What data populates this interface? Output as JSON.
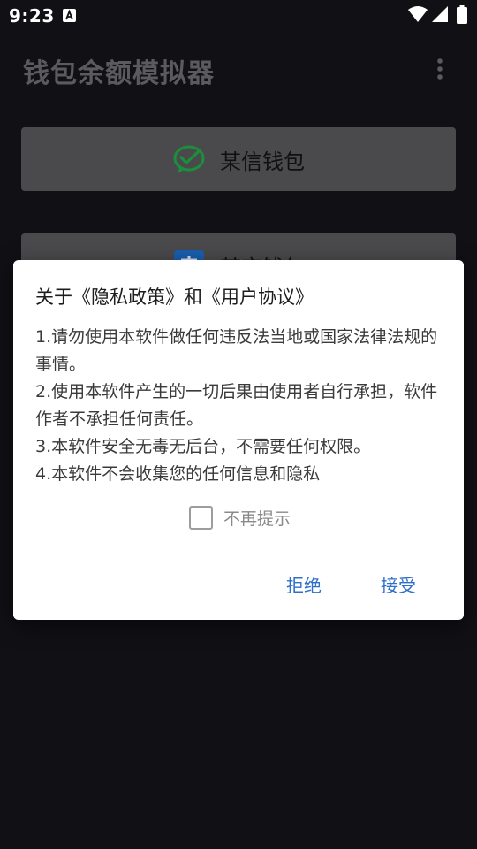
{
  "status_bar": {
    "time": "9:23",
    "icons": [
      "a-notification-icon",
      "wifi-icon",
      "signal-icon",
      "battery-icon"
    ]
  },
  "app_bar": {
    "title": "钱包余额模拟器",
    "menu_icon": "more-vert-icon"
  },
  "wallets": [
    {
      "label": "某信钱包",
      "icon": "wechat-pay-icon",
      "color": "#1b8f3c"
    },
    {
      "label": "某宝钱包",
      "icon": "alipay-icon",
      "color": "#1a5fb0"
    }
  ],
  "dialog": {
    "title": "关于《隐私政策》和《用户协议》",
    "body": [
      "1.请勿使用本软件做任何违反法当地或国家法律法规的事情。",
      "2.使用本软件产生的一切后果由使用者自行承担，软件作者不承担任何责任。",
      "3.本软件安全无毒无后台，不需要任何权限。",
      "4.本软件不会收集您的任何信息和隐私"
    ],
    "checkbox": {
      "label": "不再提示",
      "checked": false
    },
    "buttons": {
      "reject": "拒绝",
      "accept": "接受"
    }
  },
  "colors": {
    "background": "#101015",
    "accent": "#2f6fca"
  }
}
